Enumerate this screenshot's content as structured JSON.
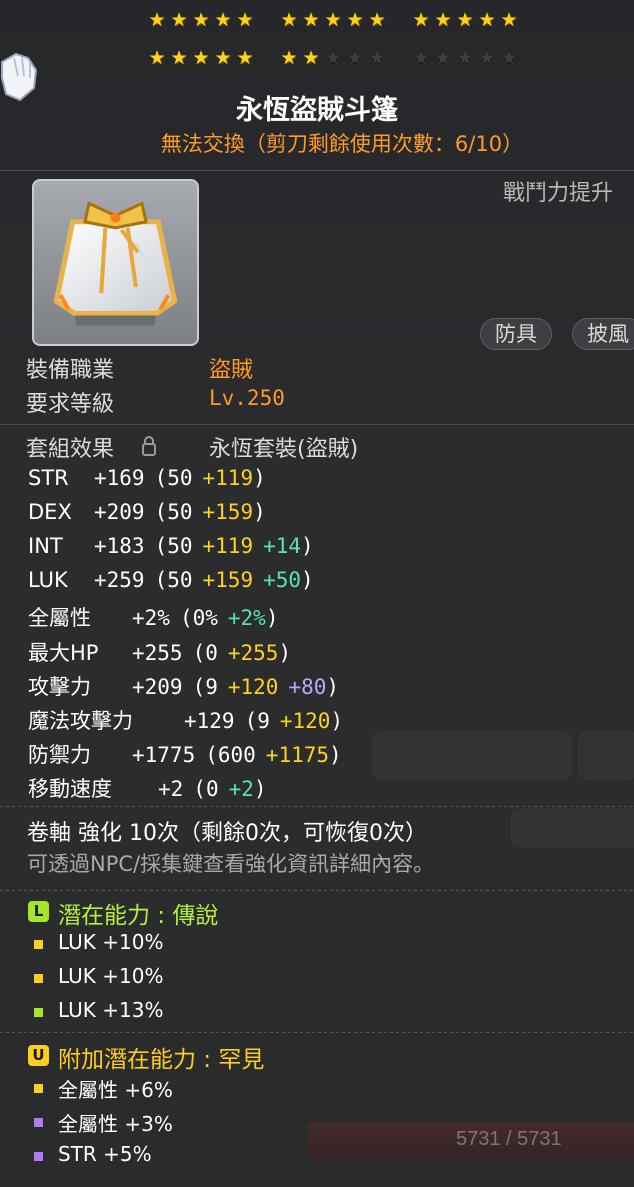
{
  "stars": {
    "row1": [
      5,
      5,
      5
    ],
    "row2": [
      5,
      2,
      0
    ],
    "per_group": 5
  },
  "item": {
    "name": "永恆盜賊斗篷",
    "trade_note": "無法交換（剪刀剩餘使用次數：6/10）",
    "power_label": "戰鬥力提升",
    "tags": [
      "防具",
      "披風"
    ],
    "icon": "cape-icon"
  },
  "requirements": {
    "job_label": "裝備職業",
    "job_value": "盜賊",
    "level_label": "要求等級",
    "level_value": "Lv.250"
  },
  "set": {
    "label": "套組效果",
    "value": "永恆套裝(盜賊)"
  },
  "stats": [
    {
      "name": "STR",
      "total": "+169",
      "open": "(50",
      "parts": [
        {
          "text": "+119",
          "color": "yellow"
        }
      ],
      "close": ")"
    },
    {
      "name": "DEX",
      "total": "+209",
      "open": "(50",
      "parts": [
        {
          "text": "+159",
          "color": "yellow"
        }
      ],
      "close": ")"
    },
    {
      "name": "INT",
      "total": "+183",
      "open": "(50",
      "parts": [
        {
          "text": "+119",
          "color": "yellow"
        },
        {
          "text": "+14",
          "color": "green"
        }
      ],
      "close": ")"
    },
    {
      "name": "LUK",
      "total": "+259",
      "open": "(50",
      "parts": [
        {
          "text": "+159",
          "color": "yellow"
        },
        {
          "text": "+50",
          "color": "green"
        }
      ],
      "close": ")"
    },
    {
      "name": "全屬性",
      "total": "+2%",
      "open": "(0%",
      "parts": [
        {
          "text": "+2%",
          "color": "green"
        }
      ],
      "close": ")"
    },
    {
      "name": "最大HP",
      "total": "+255",
      "open": "(0",
      "parts": [
        {
          "text": "+255",
          "color": "yellow"
        }
      ],
      "close": ")"
    },
    {
      "name": "攻擊力",
      "total": "+209",
      "open": "(9",
      "parts": [
        {
          "text": "+120",
          "color": "yellow"
        },
        {
          "text": "+80",
          "color": "purple"
        }
      ],
      "close": ")"
    },
    {
      "name": "魔法攻擊力",
      "total": "+129",
      "open": "(9",
      "parts": [
        {
          "text": "+120",
          "color": "yellow"
        }
      ],
      "close": ")"
    },
    {
      "name": "防禦力",
      "total": "+1775",
      "open": "(600",
      "parts": [
        {
          "text": "+1175",
          "color": "yellow"
        }
      ],
      "close": ")"
    },
    {
      "name": "移動速度",
      "total": "+2",
      "open": "(0",
      "parts": [
        {
          "text": "+2",
          "color": "green"
        }
      ],
      "close": ")"
    }
  ],
  "scroll": {
    "line": "卷軸 強化 10次（剩餘0次，可恢復0次）",
    "note": "可透過NPC/採集鍵查看強化資訊詳細內容。"
  },
  "potential": {
    "badge": "L",
    "title": "潛在能力 : 傳說",
    "lines": [
      "LUK +10%",
      "LUK +10%",
      "LUK +13%"
    ],
    "bullets": [
      "#ffcc22",
      "#ffcc22",
      "#a6e62a"
    ]
  },
  "additional": {
    "badge": "U",
    "title": "附加潛在能力 : 罕見",
    "lines": [
      "全屬性 +6%",
      "全屬性 +3%",
      "STR +5%"
    ],
    "bullets": [
      "#ffcc22",
      "#b07af0",
      "#b07af0"
    ]
  },
  "background": {
    "hp_text": "5731 / 5731"
  },
  "colors": {
    "orange": "#ff9a26",
    "yellow": "#ffd21a",
    "green": "#57e6a2",
    "purple": "#b8a8ff",
    "legend_green": "#a6e62a",
    "unique_yellow": "#ffcc22"
  }
}
